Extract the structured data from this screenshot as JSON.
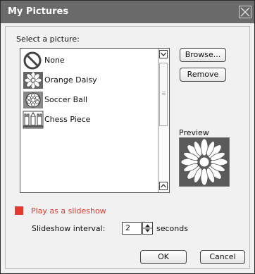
{
  "window": {
    "title": "My Pictures"
  },
  "picker": {
    "label": "Select a picture:",
    "items": [
      {
        "label": "None",
        "icon": "none-icon"
      },
      {
        "label": "Orange Daisy",
        "icon": "daisy-icon"
      },
      {
        "label": "Soccer Ball",
        "icon": "soccer-ball-icon"
      },
      {
        "label": "Chess Piece",
        "icon": "chess-piece-icon"
      }
    ]
  },
  "buttons": {
    "browse": "Browse...",
    "remove": "Remove",
    "ok": "OK",
    "cancel": "Cancel"
  },
  "preview": {
    "label": "Preview"
  },
  "slideshow": {
    "checkbox_label": "Play as a slideshow",
    "interval_label": "Slideshow interval:",
    "interval_value": "2",
    "unit": "seconds"
  },
  "colors": {
    "accent": "#e23a2e",
    "titlebar": "#6a6a6a"
  }
}
